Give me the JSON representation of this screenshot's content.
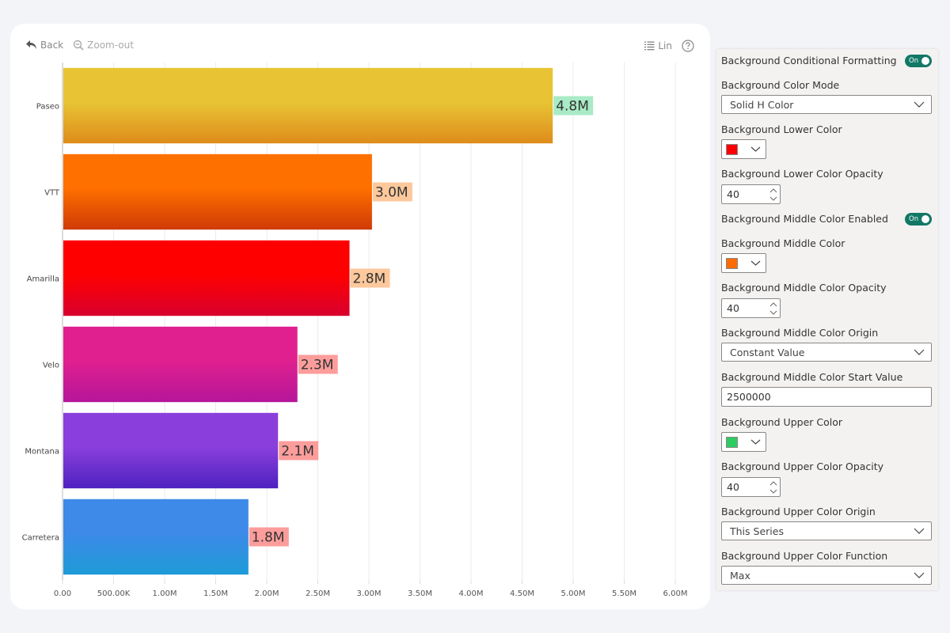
{
  "toolbar": {
    "back_label": "Back",
    "zoomout_label": "Zoom-out",
    "scale_label": "Lin",
    "back_icon": "undo-arrow-icon",
    "zoomout_icon": "zoom-out-icon",
    "scale_icon": "list-icon",
    "help_icon": "help-icon"
  },
  "chart_data": {
    "type": "bar",
    "orientation": "horizontal",
    "title": "",
    "xlabel": "",
    "ylabel": "",
    "categories": [
      "Paseo",
      "VTT",
      "Amarilla",
      "Velo",
      "Montana",
      "Carretera"
    ],
    "values": [
      4800000,
      3030000,
      2810000,
      2300000,
      2110000,
      1820000
    ],
    "data_labels": [
      "4.8M",
      "3.0M",
      "2.8M",
      "2.3M",
      "2.1M",
      "1.8M"
    ],
    "bar_colors": [
      [
        "#e8c435",
        "#de8c1a"
      ],
      [
        "#fe7000",
        "#cf3a06"
      ],
      [
        "#ff0000",
        "#d8002e"
      ],
      [
        "#e0208f",
        "#b5169a"
      ],
      [
        "#8a3fdc",
        "#4e22c0"
      ],
      [
        "#3d8ae8",
        "#1e9bd7"
      ]
    ],
    "label_backgrounds": [
      "#a8ebc6",
      "#fdc89c",
      "#fdc89c",
      "#fc9d9c",
      "#fc9d9c",
      "#fc9d9c"
    ],
    "xlim": [
      0,
      6000000
    ],
    "x_ticks": [
      0,
      500000,
      1000000,
      1500000,
      2000000,
      2500000,
      3000000,
      3500000,
      4000000,
      4500000,
      5000000,
      5500000,
      6000000
    ],
    "x_tick_labels": [
      "0.00",
      "500.00K",
      "1.00M",
      "1.50M",
      "2.00M",
      "2.50M",
      "3.00M",
      "3.50M",
      "4.00M",
      "4.50M",
      "5.00M",
      "5.50M",
      "6.00M"
    ],
    "grid": true,
    "legend": "none"
  },
  "panel": {
    "conditional_formatting": {
      "label": "Background Conditional Formatting",
      "toggle": "On"
    },
    "color_mode": {
      "label": "Background Color Mode",
      "value": "Solid H Color"
    },
    "lower_color": {
      "label": "Background Lower Color",
      "color": "#ff0000"
    },
    "lower_opacity": {
      "label": "Background Lower Color Opacity",
      "value": "40"
    },
    "middle_enabled": {
      "label": "Background Middle Color Enabled",
      "toggle": "On"
    },
    "middle_color": {
      "label": "Background Middle Color",
      "color": "#ff6a00"
    },
    "middle_opacity": {
      "label": "Background Middle Color Opacity",
      "value": "40"
    },
    "middle_origin": {
      "label": "Background Middle Color Origin",
      "value": "Constant Value"
    },
    "middle_start": {
      "label": "Background Middle Color Start Value",
      "value": "2500000"
    },
    "upper_color": {
      "label": "Background Upper Color",
      "color": "#2ecc60"
    },
    "upper_opacity": {
      "label": "Background Upper Color Opacity",
      "value": "40"
    },
    "upper_origin": {
      "label": "Background Upper Color Origin",
      "value": "This Series"
    },
    "upper_function": {
      "label": "Background Upper Color Function",
      "value": "Max"
    }
  }
}
